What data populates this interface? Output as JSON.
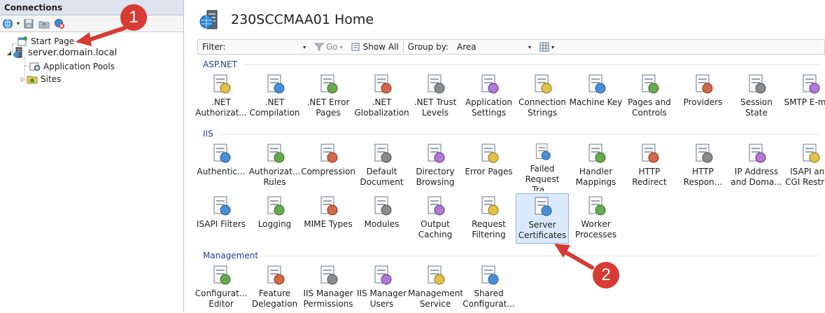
{
  "connections": {
    "title": "Connections",
    "tree": [
      {
        "label": "Start Page"
      },
      {
        "label": "server.domain.local"
      },
      {
        "label": "Application Pools"
      },
      {
        "label": "Sites"
      }
    ]
  },
  "home": {
    "title": "230SCCMAA01 Home"
  },
  "filterbar": {
    "filter_label": "Filter:",
    "filter_value": "",
    "go_label": "Go",
    "show_all_label": "Show All",
    "group_by_label": "Group by:",
    "group_by_value": "Area"
  },
  "sections": [
    {
      "name": "ASP.NET",
      "features": [
        {
          "label": ".NET Authorizat...",
          "icon": "net-authorization-icon"
        },
        {
          "label": ".NET Compilation",
          "icon": "net-compilation-icon"
        },
        {
          "label": ".NET Error Pages",
          "icon": "net-error-pages-icon"
        },
        {
          "label": ".NET Globalization",
          "icon": "net-globalization-icon"
        },
        {
          "label": ".NET Trust Levels",
          "icon": "net-trust-levels-icon"
        },
        {
          "label": "Application Settings",
          "icon": "application-settings-icon"
        },
        {
          "label": "Connection Strings",
          "icon": "connection-strings-icon"
        },
        {
          "label": "Machine Key",
          "icon": "machine-key-icon"
        },
        {
          "label": "Pages and Controls",
          "icon": "pages-and-controls-icon"
        },
        {
          "label": "Providers",
          "icon": "providers-icon"
        },
        {
          "label": "Session State",
          "icon": "session-state-icon"
        },
        {
          "label": "SMTP E-mail",
          "icon": "smtp-email-icon"
        }
      ]
    },
    {
      "name": "IIS",
      "features": [
        {
          "label": "Authentic...",
          "icon": "authentication-icon"
        },
        {
          "label": "Authorizat... Rules",
          "icon": "authorization-rules-icon"
        },
        {
          "label": "Compression",
          "icon": "compression-icon"
        },
        {
          "label": "Default Document",
          "icon": "default-document-icon"
        },
        {
          "label": "Directory Browsing",
          "icon": "directory-browsing-icon"
        },
        {
          "label": "Error Pages",
          "icon": "error-pages-icon"
        },
        {
          "label": "Failed Request Tra...",
          "icon": "failed-request-tracing-icon"
        },
        {
          "label": "Handler Mappings",
          "icon": "handler-mappings-icon"
        },
        {
          "label": "HTTP Redirect",
          "icon": "http-redirect-icon"
        },
        {
          "label": "HTTP Respon...",
          "icon": "http-response-headers-icon"
        },
        {
          "label": "IP Address and Doma...",
          "icon": "ip-address-domain-icon"
        },
        {
          "label": "ISAPI and CGI Restri...",
          "icon": "isapi-cgi-restrictions-icon"
        },
        {
          "label": "ISAPI Filters",
          "icon": "isapi-filters-icon"
        },
        {
          "label": "Logging",
          "icon": "logging-icon"
        },
        {
          "label": "MIME Types",
          "icon": "mime-types-icon"
        },
        {
          "label": "Modules",
          "icon": "modules-icon"
        },
        {
          "label": "Output Caching",
          "icon": "output-caching-icon"
        },
        {
          "label": "Request Filtering",
          "icon": "request-filtering-icon"
        },
        {
          "label": "Server Certificates",
          "icon": "server-certificates-icon",
          "selected": true
        },
        {
          "label": "Worker Processes",
          "icon": "worker-processes-icon"
        }
      ]
    },
    {
      "name": "Management",
      "features": [
        {
          "label": "Configurat... Editor",
          "icon": "configuration-editor-icon"
        },
        {
          "label": "Feature Delegation",
          "icon": "feature-delegation-icon"
        },
        {
          "label": "IIS Manager Permissions",
          "icon": "iis-manager-permissions-icon"
        },
        {
          "label": "IIS Manager Users",
          "icon": "iis-manager-users-icon"
        },
        {
          "label": "Management Service",
          "icon": "management-service-icon"
        },
        {
          "label": "Shared Configurat...",
          "icon": "shared-configuration-icon"
        }
      ]
    }
  ],
  "annotations": [
    {
      "number": "1"
    },
    {
      "number": "2"
    }
  ],
  "colors": {
    "section_header": "#1c3f8f",
    "selection": "#dbeafb",
    "annotation": "#d83a34"
  }
}
